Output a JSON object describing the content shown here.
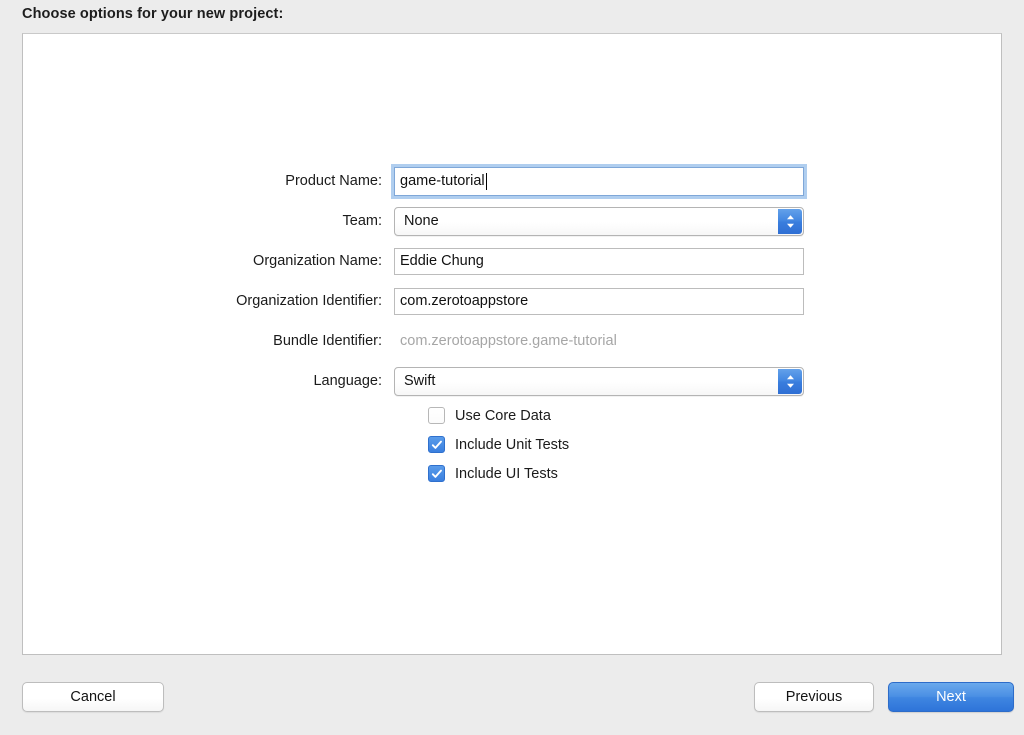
{
  "window": {
    "prompt": "Choose options for your new project:"
  },
  "form": {
    "rows": [
      {
        "id": "product-name",
        "label": "Product Name:",
        "type": "textfield",
        "value": "game-tutorial",
        "focused": true
      },
      {
        "id": "team",
        "label": "Team:",
        "type": "popup",
        "value": "None"
      },
      {
        "id": "organization-name",
        "label": "Organization Name:",
        "type": "textfield",
        "value": "Eddie Chung",
        "focused": false
      },
      {
        "id": "organization-identifier",
        "label": "Organization Identifier:",
        "type": "textfield",
        "value": "com.zerotoappstore",
        "focused": false
      },
      {
        "id": "bundle-identifier",
        "label": "Bundle Identifier:",
        "type": "static",
        "value": "com.zerotoappstore.game-tutorial"
      },
      {
        "id": "language",
        "label": "Language:",
        "type": "popup",
        "value": "Swift"
      }
    ]
  },
  "checkboxes": [
    {
      "id": "use-core-data",
      "label": "Use Core Data",
      "checked": false
    },
    {
      "id": "include-unit-tests",
      "label": "Include Unit Tests",
      "checked": true
    },
    {
      "id": "include-ui-tests",
      "label": "Include UI Tests",
      "checked": true
    }
  ],
  "buttons": {
    "cancel": "Cancel",
    "previous": "Previous",
    "next": "Next"
  },
  "colors": {
    "window_background": "#ececec",
    "panel_background": "#ffffff",
    "accent_blue": "#3a7fdf",
    "focus_ring": "#70a5e1",
    "static_text": "#a6a6a6",
    "text": "#1b1b1b"
  },
  "icons": {
    "stepper": "chevron-up-down-icon",
    "checkmark": "checkmark-icon",
    "caret": "text-caret"
  }
}
